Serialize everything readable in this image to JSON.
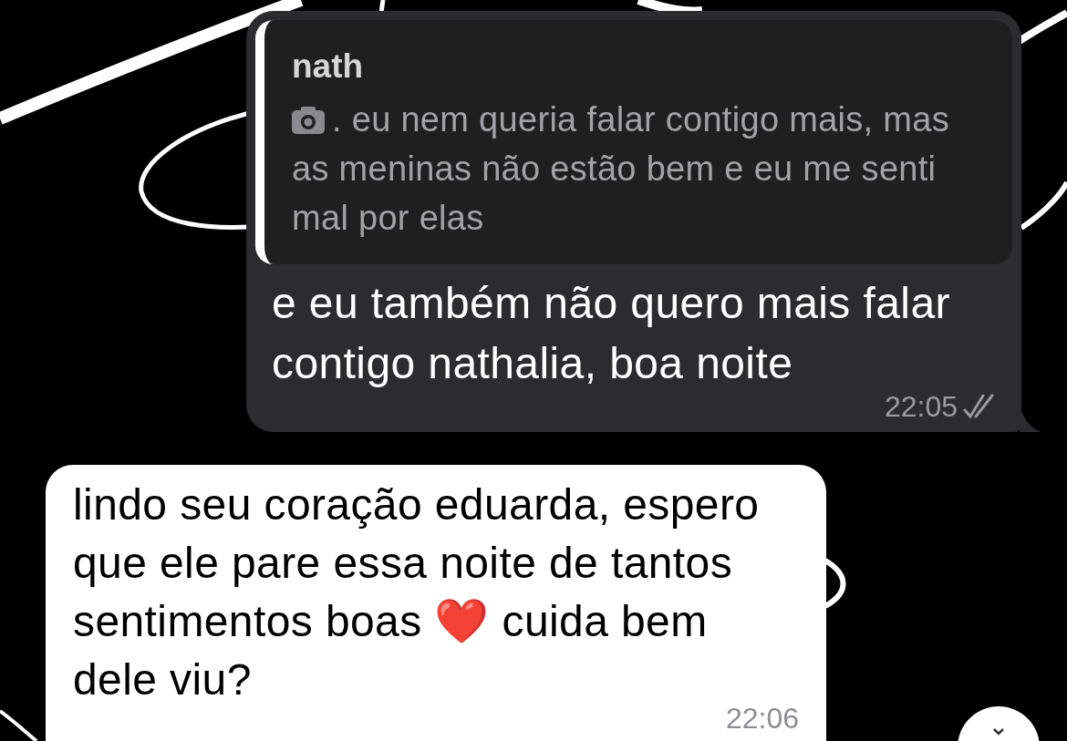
{
  "messages": [
    {
      "kind": "outgoing",
      "reply": {
        "author": "nath",
        "has_photo": true,
        "text": ". eu nem queria falar contigo mais, mas as meninas não estão bem e eu me senti mal por elas"
      },
      "parts": [
        {
          "kind": "text",
          "text": "e eu também não quero mais falar contigo nathalia, boa noite"
        }
      ],
      "time": "22:05",
      "read": true
    },
    {
      "kind": "incoming",
      "parts": [
        {
          "kind": "text",
          "text": "lindo seu coração eduarda, espero que ele pare essa noite de tantos sentimentos boas "
        },
        {
          "kind": "emoji",
          "text": "❤️"
        },
        {
          "kind": "text",
          "text": " cuida bem dele viu?"
        }
      ],
      "time": "22:06",
      "read": false
    }
  ],
  "scroll_down_button": true
}
